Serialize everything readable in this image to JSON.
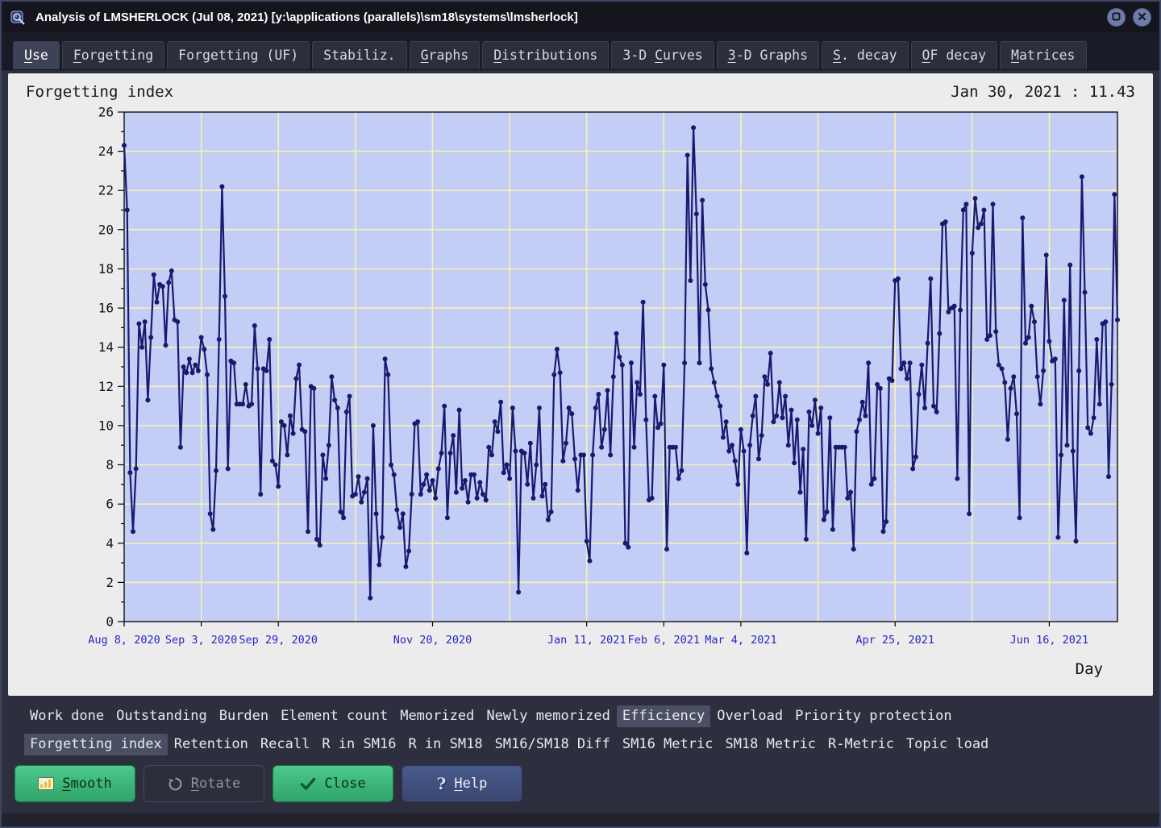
{
  "window": {
    "title": "Analysis of LMSHERLOCK (Jul 08, 2021) [y:\\applications (parallels)\\sm18\\systems\\lmsherlock]"
  },
  "tabs": [
    {
      "label": "Use",
      "underline": 0,
      "active": true
    },
    {
      "label": "Forgetting",
      "underline": 0,
      "active": false
    },
    {
      "label": "Forgetting (UF)",
      "underline": -1,
      "active": false
    },
    {
      "label": "Stabiliz.",
      "underline": -1,
      "active": false
    },
    {
      "label": "Graphs",
      "underline": 0,
      "active": false
    },
    {
      "label": "Distributions",
      "underline": 0,
      "active": false
    },
    {
      "label": "3-D Curves",
      "underline": 4,
      "active": false
    },
    {
      "label": "3-D Graphs",
      "underline": 0,
      "active": false
    },
    {
      "label": "S. decay",
      "underline": 0,
      "active": false
    },
    {
      "label": "OF decay",
      "underline": 0,
      "active": false
    },
    {
      "label": "Matrices",
      "underline": 0,
      "active": false
    }
  ],
  "panel": {
    "title": "Forgetting index",
    "readout": "Jan 30, 2021 : 11.43"
  },
  "chart_data": {
    "type": "line",
    "title": "Forgetting index",
    "xlabel": "Day",
    "ylabel": "",
    "ylim": [
      0,
      26
    ],
    "y_tick_step": 2,
    "x_gridline_interval_days": 26,
    "x_ticks": [
      {
        "day": 0,
        "label": "Aug 8, 2020"
      },
      {
        "day": 26,
        "label": "Sep 3, 2020"
      },
      {
        "day": 52,
        "label": "Sep 29, 2020"
      },
      {
        "day": 104,
        "label": "Nov 20, 2020"
      },
      {
        "day": 156,
        "label": "Jan 11, 2021"
      },
      {
        "day": 182,
        "label": "Feb 6, 2021"
      },
      {
        "day": 208,
        "label": "Mar 4, 2021"
      },
      {
        "day": 260,
        "label": "Apr 25, 2021"
      },
      {
        "day": 312,
        "label": "Jun 16, 2021"
      }
    ],
    "grid": true,
    "legend": false,
    "colors": {
      "line": "#191970",
      "plot_bg": "#c3cdf6",
      "grid": "#f7f2b4",
      "axis": "#000000",
      "x_tick_label": "#2626c9",
      "y_tick_label": "#111111"
    },
    "series": [
      {
        "name": "Forgetting index",
        "values": [
          24.3,
          21.0,
          7.6,
          4.6,
          7.8,
          15.2,
          14.0,
          15.3,
          11.3,
          14.5,
          17.7,
          16.3,
          17.2,
          17.1,
          14.1,
          17.3,
          17.9,
          15.4,
          15.3,
          8.9,
          13.0,
          12.7,
          13.4,
          12.7,
          13.1,
          12.8,
          14.5,
          13.9,
          12.6,
          5.5,
          4.7,
          7.7,
          14.4,
          22.2,
          16.6,
          7.8,
          13.3,
          13.2,
          11.1,
          11.1,
          11.1,
          12.1,
          11.0,
          11.1,
          15.1,
          12.9,
          6.5,
          12.9,
          12.8,
          14.4,
          8.2,
          8.0,
          6.9,
          10.2,
          10.0,
          8.5,
          10.5,
          9.6,
          12.4,
          13.1,
          9.8,
          9.7,
          4.6,
          12.0,
          11.9,
          4.2,
          3.9,
          8.5,
          7.3,
          9.0,
          12.5,
          11.3,
          10.9,
          5.6,
          5.3,
          10.7,
          11.5,
          6.4,
          6.5,
          7.4,
          6.1,
          6.6,
          7.3,
          1.2,
          10.0,
          5.5,
          2.9,
          4.3,
          13.4,
          12.6,
          8.0,
          7.5,
          5.7,
          4.8,
          5.5,
          2.8,
          3.6,
          6.5,
          10.1,
          10.2,
          6.5,
          7.0,
          7.5,
          6.7,
          7.2,
          6.3,
          7.8,
          8.6,
          11.0,
          5.3,
          8.6,
          9.5,
          6.6,
          10.8,
          6.8,
          7.2,
          6.1,
          7.5,
          7.5,
          6.3,
          7.1,
          6.5,
          6.2,
          8.9,
          8.5,
          10.2,
          9.7,
          11.2,
          7.6,
          8.0,
          7.3,
          10.9,
          8.7,
          1.5,
          8.7,
          8.6,
          7.0,
          9.1,
          6.3,
          8.0,
          10.9,
          6.4,
          7.0,
          5.2,
          5.6,
          12.6,
          13.9,
          12.7,
          8.2,
          9.1,
          10.9,
          10.6,
          8.3,
          6.7,
          8.5,
          8.5,
          4.1,
          3.1,
          8.5,
          10.9,
          11.6,
          8.9,
          9.8,
          11.8,
          8.5,
          12.5,
          14.7,
          13.5,
          13.1,
          4.0,
          3.8,
          13.2,
          8.9,
          12.2,
          11.6,
          16.3,
          10.3,
          6.2,
          6.3,
          11.5,
          9.9,
          10.1,
          13.1,
          3.7,
          8.9,
          8.9,
          8.9,
          7.3,
          7.7,
          13.2,
          23.8,
          17.4,
          25.2,
          20.8,
          13.2,
          21.5,
          17.2,
          15.9,
          12.9,
          12.2,
          11.5,
          11.0,
          9.4,
          10.2,
          8.7,
          9.0,
          8.2,
          7.0,
          9.8,
          8.7,
          3.5,
          9.0,
          10.5,
          11.5,
          8.3,
          9.5,
          12.5,
          12.1,
          13.7,
          10.2,
          10.5,
          12.2,
          10.4,
          11.5,
          9.0,
          10.8,
          8.1,
          10.3,
          6.6,
          8.8,
          4.2,
          10.7,
          10.0,
          11.3,
          9.6,
          10.9,
          5.2,
          5.6,
          10.4,
          4.7,
          8.9,
          8.9,
          8.9,
          8.9,
          6.3,
          6.6,
          3.7,
          9.7,
          10.3,
          11.2,
          10.5,
          13.2,
          7.0,
          7.3,
          12.1,
          11.9,
          4.6,
          5.1,
          12.4,
          12.3,
          17.4,
          17.5,
          12.9,
          13.2,
          12.4,
          13.2,
          7.8,
          8.4,
          11.6,
          13.1,
          10.9,
          14.2,
          17.5,
          11.0,
          10.7,
          14.7,
          20.3,
          20.4,
          15.8,
          16.0,
          16.1,
          7.3,
          15.9,
          21.0,
          21.3,
          5.5,
          18.8,
          21.6,
          20.1,
          20.3,
          21.0,
          14.4,
          14.6,
          21.3,
          14.8,
          13.1,
          12.9,
          12.2,
          9.3,
          11.9,
          12.5,
          10.6,
          5.3,
          20.6,
          14.2,
          14.5,
          16.1,
          15.3,
          12.5,
          11.1,
          12.8,
          18.7,
          14.3,
          13.3,
          13.4,
          4.3,
          8.5,
          16.4,
          9.0,
          18.2,
          8.7,
          4.1,
          12.8,
          22.7,
          16.8,
          9.9,
          9.6,
          10.4,
          14.4,
          11.1,
          15.2,
          15.3,
          7.4,
          12.1,
          21.8,
          15.4
        ]
      }
    ]
  },
  "analysis_menu": {
    "row1": [
      {
        "label": "Work done",
        "selected": false
      },
      {
        "label": "Outstanding",
        "selected": false
      },
      {
        "label": "Burden",
        "selected": false
      },
      {
        "label": "Element count",
        "selected": false
      },
      {
        "label": "Memorized",
        "selected": false
      },
      {
        "label": "Newly memorized",
        "selected": false
      },
      {
        "label": "Efficiency",
        "selected": true
      },
      {
        "label": "Overload",
        "selected": false
      },
      {
        "label": "Priority protection",
        "selected": false
      }
    ],
    "row2": [
      {
        "label": "Forgetting index",
        "selected": true
      },
      {
        "label": "Retention",
        "selected": false
      },
      {
        "label": "Recall",
        "selected": false
      },
      {
        "label": "R in SM16",
        "selected": false
      },
      {
        "label": "R in SM18",
        "selected": false
      },
      {
        "label": "SM16/SM18 Diff",
        "selected": false
      },
      {
        "label": "SM16 Metric",
        "selected": false
      },
      {
        "label": "SM18 Metric",
        "selected": false
      },
      {
        "label": "R-Metric",
        "selected": false
      },
      {
        "label": "Topic load",
        "selected": false
      }
    ]
  },
  "buttons": [
    {
      "label": "Smooth",
      "underline": 0,
      "icon": "smooth-chart-icon",
      "variant": "green",
      "enabled": true
    },
    {
      "label": "Rotate",
      "underline": 0,
      "icon": "rotate-icon",
      "variant": "dark",
      "enabled": false
    },
    {
      "label": "Close",
      "underline": -1,
      "icon": "check-icon",
      "variant": "green",
      "enabled": true
    },
    {
      "label": "Help",
      "underline": 0,
      "icon": "help-icon",
      "variant": "blue",
      "enabled": true
    }
  ]
}
